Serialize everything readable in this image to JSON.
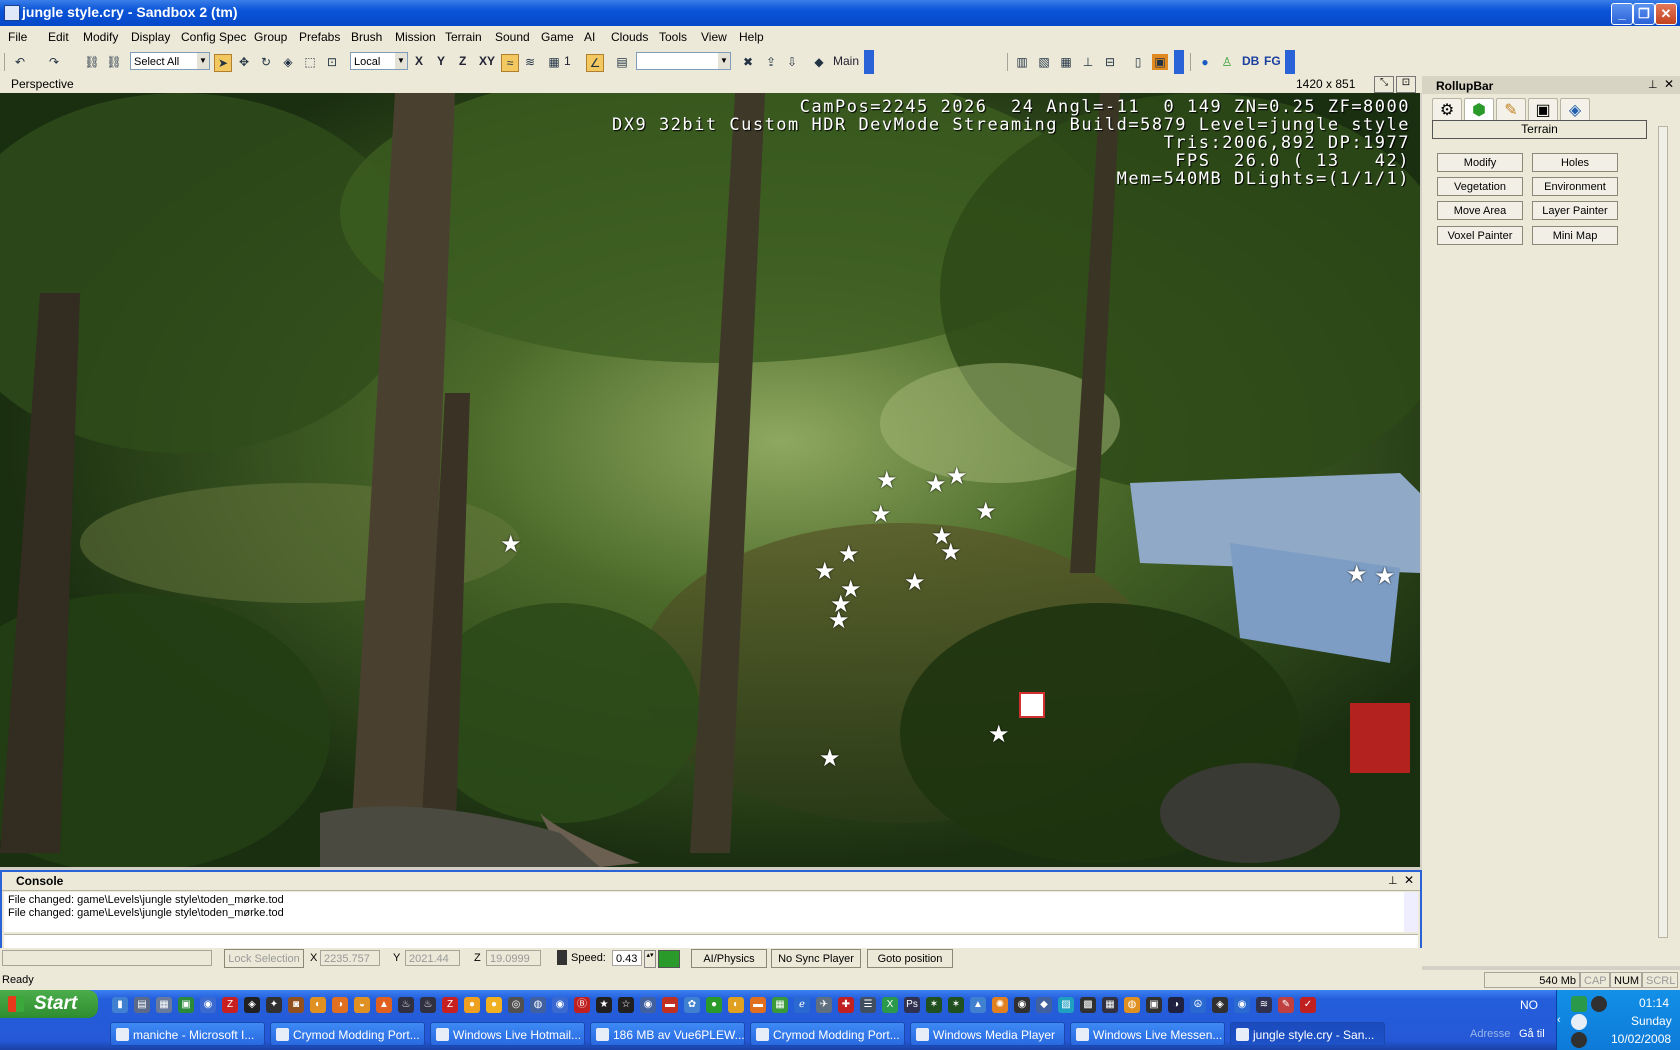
{
  "window": {
    "title": "jungle style.cry - Sandbox 2 (tm)"
  },
  "menu": [
    "File",
    "Edit",
    "Modify",
    "Display",
    "Config Spec",
    "Group",
    "Prefabs",
    "Brush",
    "Mission",
    "Terrain",
    "Sound",
    "Game",
    "AI",
    "Clouds",
    "Tools",
    "View",
    "Help"
  ],
  "toolbar": {
    "select_combo": "Select All",
    "coord_combo": "Local",
    "axes": [
      "X",
      "Y",
      "Z",
      "XY"
    ],
    "grid_value": "1",
    "layer_label": "Main",
    "db_label": "DB",
    "fg_label": "FG"
  },
  "viewport": {
    "name": "Perspective",
    "resolution": "1420 x 851",
    "info_lines": [
      "CamPos=2245 2026  24 Angl=-11  0 149 ZN=0.25 ZF=8000",
      "DX9 32bit Custom HDR DevMode Streaming Build=5879 Level=jungle style",
      "Tris:2006,892 DP:1977",
      "FPS  26.0 ( 13   42)",
      "Mem=540MB DLights=(1/1/1)"
    ]
  },
  "rollup": {
    "title": "RollupBar",
    "section": "Terrain",
    "buttons": [
      "Modify",
      "Holes",
      "Vegetation",
      "Environment",
      "Move Area",
      "Layer Painter",
      "Voxel Painter",
      "Mini Map"
    ]
  },
  "console": {
    "title": "Console",
    "lines": [
      "File changed: game\\Levels\\jungle style\\toden_mørke.tod",
      "File changed: game\\Levels\\jungle style\\toden_mørke.tod"
    ]
  },
  "statusrow": {
    "lock_selection": "Lock Selection",
    "x_label": "X",
    "x_value": "2235.757",
    "y_label": "Y",
    "y_value": "2021.44",
    "z_label": "Z",
    "z_value": "19.0999",
    "speed_label": "Speed:",
    "speed_value": "0.43",
    "ai_physics": "AI/Physics",
    "no_sync": "No Sync Player",
    "goto": "Goto position"
  },
  "statusbar": {
    "ready": "Ready",
    "mem": "540 Mb",
    "cap": "CAP",
    "num": "NUM",
    "scrl": "SCRL"
  },
  "taskbar": {
    "start": "Start",
    "tasks": [
      "maniche - Microsoft I...",
      "Crymod Modding Port...",
      "Windows Live Hotmail...",
      "186 MB av Vue6PLEW...",
      "Crymod Modding Port...",
      "Windows Media Player",
      "Windows Live Messen...",
      "jungle style.cry - San..."
    ],
    "lang": "NO",
    "address_label": "Adresse",
    "go_label": "Gå til",
    "time": "01:14",
    "day": "Sunday",
    "date": "10/02/2008"
  },
  "colors": {
    "xp_blue": "#245edb",
    "start_green": "#3a9a3a",
    "console_border": "#2a62d8"
  }
}
